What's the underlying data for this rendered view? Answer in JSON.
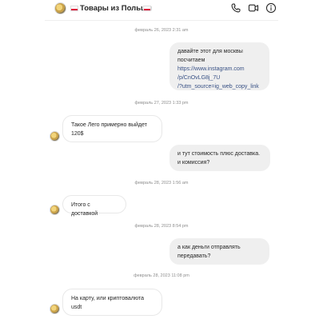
{
  "header": {
    "title": "Товары из Польши",
    "icons": [
      "phone-icon",
      "video-camera-icon",
      "info-icon"
    ]
  },
  "messages": {
    "ts1": "февраль 26, 2023 2:31 am",
    "m1_line1": "давайте этот для москвы",
    "m1_line2": "посчитаем",
    "m1_link1": "https://www.instagram.com",
    "m1_link2": "/p/CnOvLG8j_7U",
    "m1_link3": "/?utm_source=ig_web_copy_link",
    "ts2": "февраль 27, 2023 1:33 pm",
    "m2_line1": "Такое Лего примерно выйдет",
    "m2_line2": "120$",
    "m3_line1": "и тут стоимость плюс доставка.",
    "m3_line2": "и комиссия?",
    "ts3": "февраль 28, 2023 1:56 am",
    "m4": "Итого с доставкой",
    "ts4": "февраль 28, 2023 8:54 pm",
    "m5_line1": "а как деньги отправлять",
    "m5_line2": "передавать?",
    "ts5": "февраль 28, 2023 11:08 pm",
    "m6_line1": "На карту, или криптовалюта",
    "m6_line2": "usdt"
  }
}
